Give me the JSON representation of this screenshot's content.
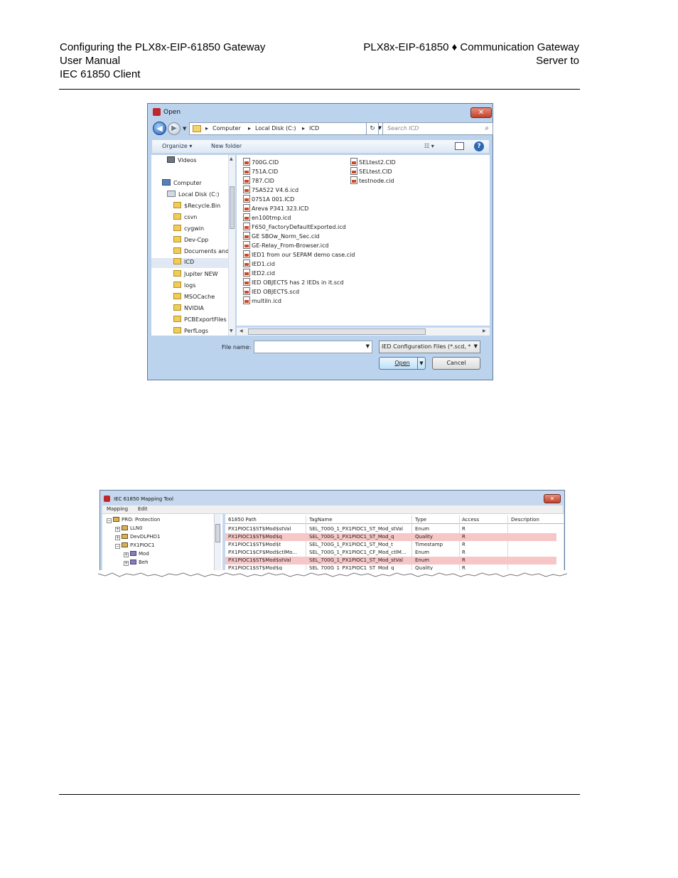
{
  "header": {
    "left_lines": [
      "Configuring the PLX8x-EIP-61850 Gateway",
      "User Manual",
      "IEC 61850 Client"
    ],
    "right_lines": [
      "PLX8x-EIP-61850 ♦ Communication Gateway",
      "Server to"
    ]
  },
  "open_dialog": {
    "title": "Open",
    "close_label": "✕",
    "address": [
      "Computer",
      "Local Disk (C:)",
      "ICD"
    ],
    "search_placeholder": "Search ICD",
    "toolbar": {
      "organize": "Organize ▾",
      "new_folder": "New folder"
    },
    "nav_tree": [
      {
        "label": "Videos",
        "icon": "video-library-icon"
      },
      {
        "label": "Computer",
        "icon": "computer-icon"
      },
      {
        "label": "Local Disk (C:)",
        "icon": "drive-icon"
      },
      {
        "label": "$Recycle.Bin",
        "icon": "folder-icon"
      },
      {
        "label": "csvn",
        "icon": "folder-icon"
      },
      {
        "label": "cygwin",
        "icon": "folder-icon"
      },
      {
        "label": "Dev-Cpp",
        "icon": "folder-icon"
      },
      {
        "label": "Documents and",
        "icon": "folder-icon"
      },
      {
        "label": "ICD",
        "icon": "folder-icon",
        "selected": true
      },
      {
        "label": "Jupiter NEW",
        "icon": "folder-icon"
      },
      {
        "label": "logs",
        "icon": "folder-icon"
      },
      {
        "label": "MSOCache",
        "icon": "folder-icon"
      },
      {
        "label": "NVIDIA",
        "icon": "folder-icon"
      },
      {
        "label": "PCBExportFiles",
        "icon": "folder-icon"
      },
      {
        "label": "PerfLogs",
        "icon": "folder-icon"
      }
    ],
    "files_col1": [
      "700G.CID",
      "751A.CID",
      "787.CID",
      "7SA522 V4.6.icd",
      "0751A 001.ICD",
      "Areva P341 323.ICD",
      "en100tmp.icd",
      "F650_FactoryDefaultExported.icd",
      "GE SBOw_Norm_Sec.cid",
      "GE-Relay_From-Browser.icd",
      "IED1 from our SEPAM demo case.cid",
      "IED1.cid",
      "IED2.cid",
      "IED OBJECTS has 2 IEDs in it.scd",
      "IED OBJECTS.scd",
      "multiln.icd"
    ],
    "files_col2": [
      "SELtest2.CID",
      "SELtest.CID",
      "testnode.cid"
    ],
    "file_name_label": "File name:",
    "file_name_value": "",
    "file_type": "IED Configuration Files (*.scd, *",
    "open_button": "Open",
    "cancel_button": "Cancel"
  },
  "mapping_tool": {
    "title": "IEC 61850 Mapping Tool",
    "close_label": "✕",
    "menu": [
      "Mapping",
      "Edit"
    ],
    "tree": [
      {
        "label": "PRO: Protection",
        "box": "⊟",
        "indent": 0,
        "kind": "ld"
      },
      {
        "label": "LLN0",
        "box": "⊞",
        "indent": 1,
        "kind": "ln"
      },
      {
        "label": "DevDLPHD1",
        "box": "⊞",
        "indent": 1,
        "kind": "ln"
      },
      {
        "label": "PX1PIOC1",
        "box": "⊟",
        "indent": 1,
        "kind": "ln"
      },
      {
        "label": "Mod",
        "box": "⊞",
        "indent": 2,
        "kind": "do"
      },
      {
        "label": "Beh",
        "box": "⊞",
        "indent": 2,
        "kind": "do"
      }
    ],
    "columns": [
      "61850 Path",
      "TagName",
      "Type",
      "Access",
      "Description"
    ],
    "rows": [
      {
        "path": "PX1PIOC1$ST$Mod$stVal",
        "tag": "SEL_700G_1_PX1PIOC1_ST_Mod_stVal",
        "type": "Enum",
        "access": "R",
        "desc": "",
        "highlight": false
      },
      {
        "path": "PX1PIOC1$ST$Mod$q",
        "tag": "SEL_700G_1_PX1PIOC1_ST_Mod_q",
        "type": "Quality",
        "access": "R",
        "desc": "",
        "highlight": true
      },
      {
        "path": "PX1PIOC1$ST$Mod$t",
        "tag": "SEL_700G_1_PX1PIOC1_ST_Mod_t",
        "type": "Timestamp",
        "access": "R",
        "desc": "",
        "highlight": false
      },
      {
        "path": "PX1PIOC1$CF$Mod$ctlMo...",
        "tag": "SEL_700G_1_PX1PIOC1_CF_Mod_ctlM...",
        "type": "Enum",
        "access": "R",
        "desc": "",
        "highlight": false
      },
      {
        "path": "PX1PIOC1$ST$Mod$stVal",
        "tag": "SEL_700G_1_PX1PIOC1_ST_Mod_stVal",
        "type": "Enum",
        "access": "R",
        "desc": "",
        "highlight": true
      },
      {
        "path": "PX1PIOC1$ST$Mod$q",
        "tag": "SEL_700G_1_PX1PIOC1_ST_Mod_q",
        "type": "Quality",
        "access": "R",
        "desc": "",
        "highlight": false
      }
    ]
  }
}
